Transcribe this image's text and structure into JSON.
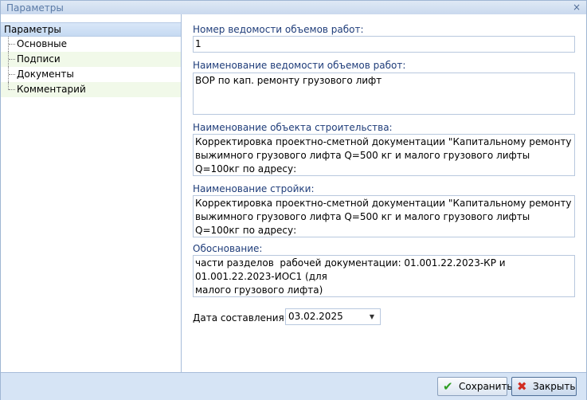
{
  "window": {
    "title": "Параметры",
    "close_glyph": "×"
  },
  "sidebar": {
    "header": "Параметры",
    "items": [
      {
        "label": "Основные"
      },
      {
        "label": "Подписи"
      },
      {
        "label": "Документы"
      },
      {
        "label": "Комментарий"
      }
    ]
  },
  "form": {
    "number_label": "Номер ведомости объемов работ:",
    "number_value": "1",
    "name_label": "Наименование ведомости объемов работ:",
    "name_value": "ВОР по кап. ремонту грузового лифт",
    "object_label": "Наименование объекта строительства:",
    "object_value": "Корректировка проектно-сметной документации \"Капитальному ремонту\nвыжимного грузового лифта Q=500 кг и малого грузового лифты Q=100кг по адресу:\nТомская область, Томский район, пос. Ключи\"",
    "construction_label": "Наименование стройки:",
    "construction_value": "Корректировка проектно-сметной документации \"Капитальному ремонту\nвыжимного грузового лифта Q=500 кг и малого грузового лифты Q=100кг по адресу:\nТомская область, Томский район, пос. Ключи\"",
    "basis_label": "Обоснование:",
    "basis_value": "части разделов  рабочей документации: 01.001.22.2023-КР и 01.001.22.2023-ИОС1 (для\nмалого грузового лифта)",
    "date_label": "Дата составления:",
    "date_value": "03.02.2025",
    "date_dropdown_glyph": "▼"
  },
  "footer": {
    "save_label": "Сохранить",
    "save_icon": "✔",
    "close_label": "Закрыть",
    "close_icon": "✖"
  },
  "colors": {
    "accent_label": "#1f3d7a",
    "title_text": "#5a7aa6",
    "save_icon": "#2f9e23",
    "close_icon": "#d12d22"
  }
}
